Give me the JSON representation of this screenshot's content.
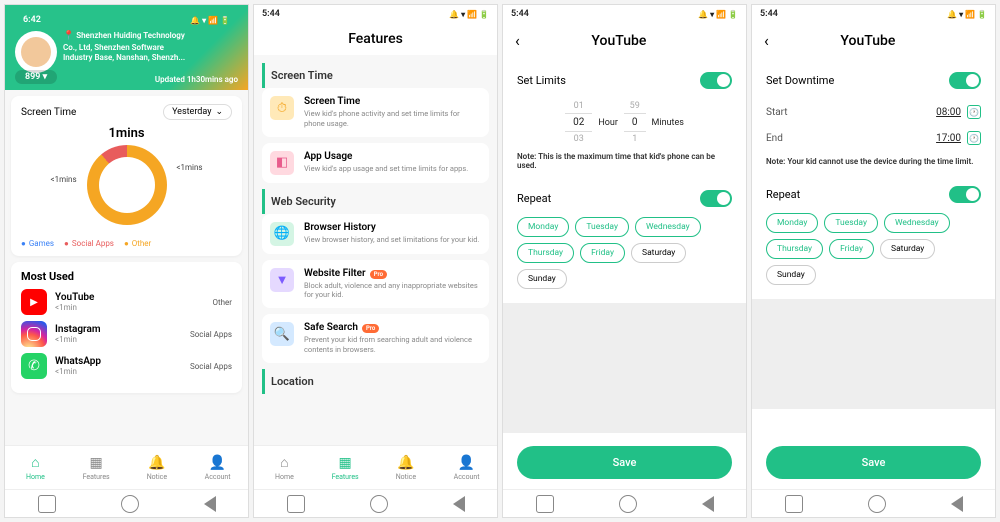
{
  "screen1": {
    "status_time": "6:42",
    "location": {
      "line1": "Shenzhen Huiding Technology",
      "line2": "Co., Ltd, Shenzhen Software",
      "line3": "Industry Base, Nanshan, Shenzh..."
    },
    "updated": "Updated 1h30mins ago",
    "child_name": "899",
    "screentime_label": "Screen Time",
    "period": "Yesterday",
    "total": "1mins",
    "donut_left": "<1mins",
    "donut_right": "<1mins",
    "legend": {
      "games": "Games",
      "social": "Social Apps",
      "other": "Other"
    },
    "most_used_label": "Most Used",
    "apps": [
      {
        "name": "YouTube",
        "time": "<1min",
        "category": "Other"
      },
      {
        "name": "Instagram",
        "time": "<1min",
        "category": "Social Apps"
      },
      {
        "name": "WhatsApp",
        "time": "<1min",
        "category": "Social Apps"
      }
    ],
    "tabs": {
      "home": "Home",
      "features": "Features",
      "notice": "Notice",
      "account": "Account"
    }
  },
  "screen2": {
    "status_time": "5:44",
    "title": "Features",
    "sections": {
      "screen_time": "Screen Time",
      "web_security": "Web Security",
      "location": "Location"
    },
    "items": {
      "screen_time": {
        "title": "Screen Time",
        "desc": "View kid's phone activity and set time limits for phone usage."
      },
      "app_usage": {
        "title": "App Usage",
        "desc": "View kid's app usage and set time limits for apps."
      },
      "browser_history": {
        "title": "Browser History",
        "desc": "View browser history, and set limitations for your kid."
      },
      "website_filter": {
        "title": "Website Filter",
        "desc": "Block adult, violence and any inappropriate websites for your kid.",
        "pro": "Pro"
      },
      "safe_search": {
        "title": "Safe Search",
        "desc": "Prevent your kid from searching adult and violence contents in browsers.",
        "pro": "Pro"
      }
    }
  },
  "screen3": {
    "status_time": "5:44",
    "title": "YouTube",
    "set_limits": "Set Limits",
    "picker": {
      "prev_h": "01",
      "hour": "02",
      "next_h": "03",
      "hour_label": "Hour",
      "prev_m": "59",
      "min": "0",
      "next_m": "1",
      "min_label": "Minutes"
    },
    "note": "Note: This is the maximum time that kid's phone can be used.",
    "repeat": "Repeat",
    "days": [
      {
        "label": "Monday",
        "on": true
      },
      {
        "label": "Tuesday",
        "on": true
      },
      {
        "label": "Wednesday",
        "on": true
      },
      {
        "label": "Thursday",
        "on": true
      },
      {
        "label": "Friday",
        "on": true
      },
      {
        "label": "Saturday",
        "on": false
      },
      {
        "label": "Sunday",
        "on": false
      }
    ],
    "save": "Save"
  },
  "screen4": {
    "status_time": "5:44",
    "title": "YouTube",
    "set_downtime": "Set Downtime",
    "start_label": "Start",
    "start_time": "08:00",
    "end_label": "End",
    "end_time": "17:00",
    "note": "Note: Your kid cannot use the device during the time limit.",
    "repeat": "Repeat",
    "days": [
      {
        "label": "Monday",
        "on": true
      },
      {
        "label": "Tuesday",
        "on": true
      },
      {
        "label": "Wednesday",
        "on": true
      },
      {
        "label": "Thursday",
        "on": true
      },
      {
        "label": "Friday",
        "on": true
      },
      {
        "label": "Saturday",
        "on": false
      },
      {
        "label": "Sunday",
        "on": false
      }
    ],
    "save": "Save"
  }
}
